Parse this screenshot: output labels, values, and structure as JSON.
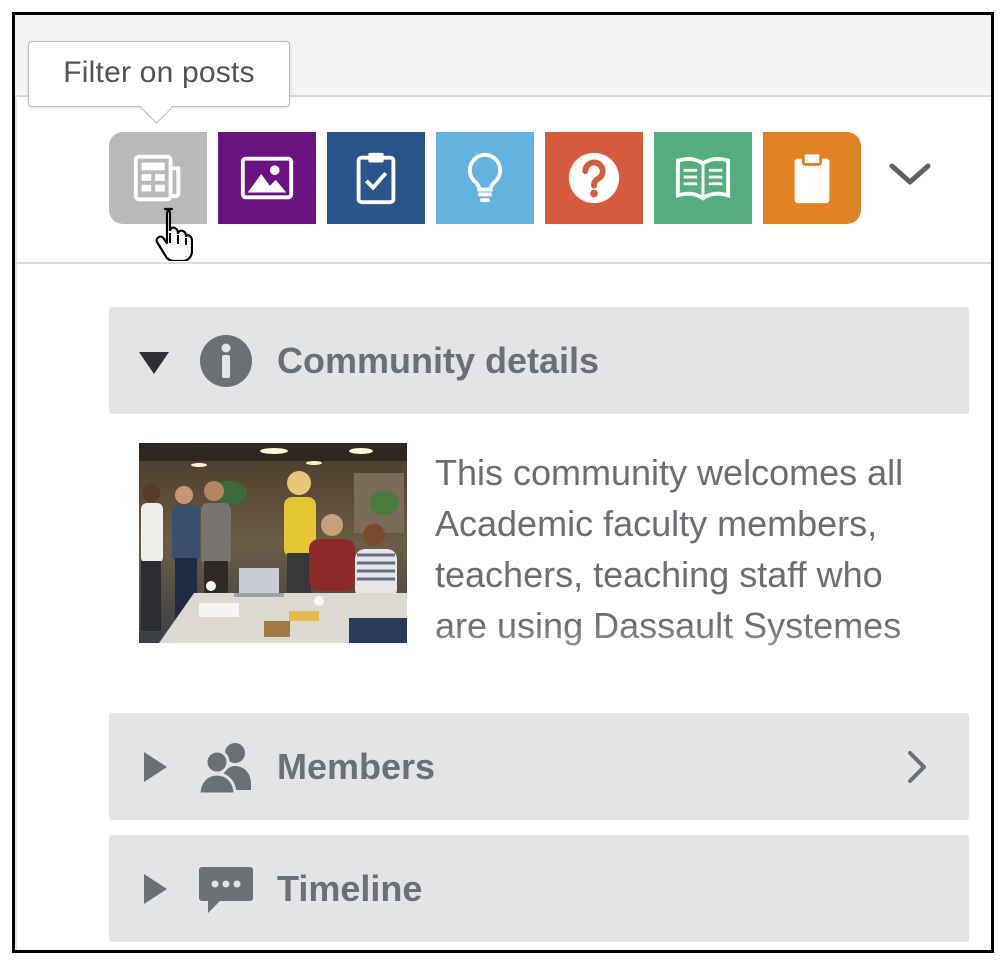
{
  "tooltip": {
    "text": "Filter on posts"
  },
  "filters": [
    {
      "name": "posts",
      "icon": "newspaper-icon",
      "color": "#b8b9bb"
    },
    {
      "name": "media",
      "icon": "image-icon",
      "color": "#6a1480"
    },
    {
      "name": "surveys",
      "icon": "clipboard-check-icon",
      "color": "#2b538c"
    },
    {
      "name": "ideas",
      "icon": "lightbulb-icon",
      "color": "#63b3de"
    },
    {
      "name": "questions",
      "icon": "question-circle-icon",
      "color": "#d65a3e"
    },
    {
      "name": "wiki",
      "icon": "open-book-icon",
      "color": "#56ae7f"
    },
    {
      "name": "documents",
      "icon": "clipboard-icon",
      "color": "#e08221"
    }
  ],
  "sections": {
    "details": {
      "title": "Community details",
      "icon": "info-circle-icon",
      "expanded": true
    },
    "members": {
      "title": "Members",
      "icon": "users-icon",
      "expanded": false
    },
    "timeline": {
      "title": "Timeline",
      "icon": "chat-bubble-icon",
      "expanded": false
    }
  },
  "community": {
    "description": "This community welcomes all Academic faculty members, teachers, teaching staff who are using Dassault Systemes"
  },
  "colors": {
    "panel_bg": "#e3e4e5",
    "panel_text": "#6c6f74",
    "body_text": "#6a6d72"
  }
}
